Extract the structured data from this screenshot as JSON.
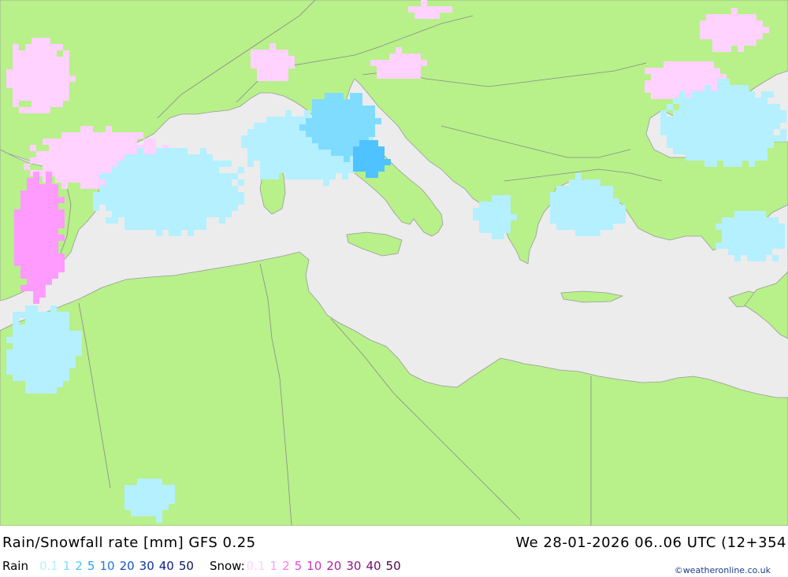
{
  "map": {
    "colors": {
      "sea": "#ececec",
      "land": "#b8f08a",
      "border": "#8a8a8a",
      "coast": "#9a9a9a"
    }
  },
  "footer": {
    "title": "Rain/Snowfall rate [mm] GFS 0.25",
    "time": "We 28-01-2026 06..06 UTC (12+354",
    "credit": "©weatheronline.co.uk"
  },
  "legend": {
    "rain_label": "Rain",
    "snow_label": "Snow:",
    "rain": [
      {
        "v": "0.1",
        "color": "#b4f0ff"
      },
      {
        "v": "1",
        "color": "#7fdcff"
      },
      {
        "v": "2",
        "color": "#4fc3ff"
      },
      {
        "v": "5",
        "color": "#2aa0f0"
      },
      {
        "v": "10",
        "color": "#1e78e6"
      },
      {
        "v": "20",
        "color": "#1450c8"
      },
      {
        "v": "30",
        "color": "#0a32a0"
      },
      {
        "v": "40",
        "color": "#0a1e82"
      },
      {
        "v": "50",
        "color": "#0a1464"
      }
    ],
    "snow": [
      {
        "v": "0.1",
        "color": "#ffd2ff"
      },
      {
        "v": "1",
        "color": "#ff9bff"
      },
      {
        "v": "2",
        "color": "#ff78ff"
      },
      {
        "v": "5",
        "color": "#e646e6"
      },
      {
        "v": "10",
        "color": "#c832c8"
      },
      {
        "v": "20",
        "color": "#aa1eaa"
      },
      {
        "v": "30",
        "color": "#8c148c"
      },
      {
        "v": "40",
        "color": "#6e0a6e"
      },
      {
        "v": "50",
        "color": "#500050"
      }
    ]
  }
}
